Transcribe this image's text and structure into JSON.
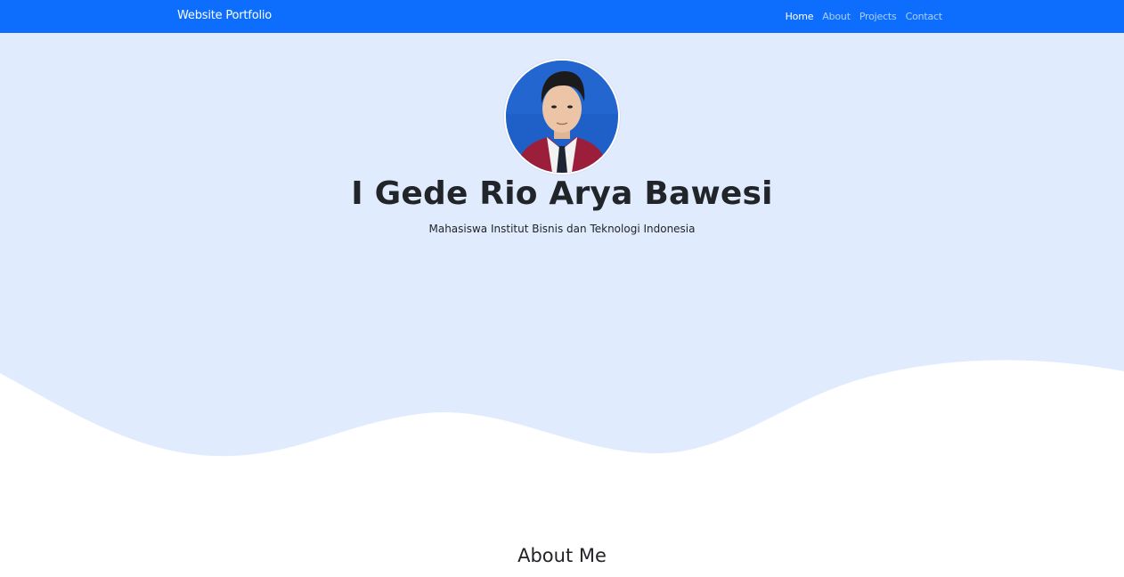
{
  "navbar": {
    "brand": "Website Portfolio",
    "links": [
      {
        "label": "Home",
        "active": true
      },
      {
        "label": "About",
        "active": false
      },
      {
        "label": "Projects",
        "active": false
      },
      {
        "label": "Contact",
        "active": false
      }
    ]
  },
  "hero": {
    "name": "I Gede Rio Arya Bawesi",
    "subtitle": "Mahasiswa Institut Bisnis dan Teknologi Indonesia"
  },
  "about": {
    "title": "About Me"
  },
  "colors": {
    "primary": "#0d6efd",
    "hero_bg": "#e0ecfd",
    "text": "#212529"
  }
}
